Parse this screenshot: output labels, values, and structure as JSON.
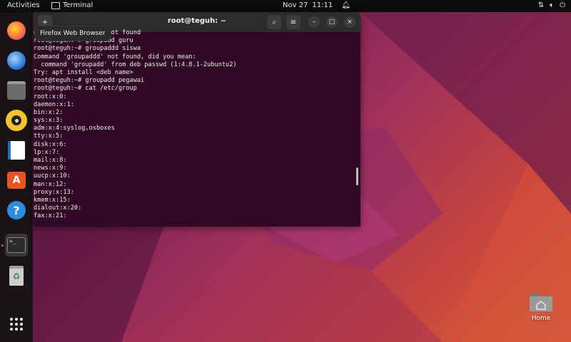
{
  "topbar": {
    "activities": "Activities",
    "app_name": "Terminal",
    "date": "Nov 27",
    "time": "11:11"
  },
  "tooltip": {
    "text": "Firefox Web Browser"
  },
  "dock": {
    "items": [
      {
        "icon": "firefox-icon"
      },
      {
        "icon": "thunderbird-icon"
      },
      {
        "icon": "files-icon"
      },
      {
        "icon": "rhythmbox-icon"
      },
      {
        "icon": "libreoffice-writer-icon"
      },
      {
        "icon": "app-center-icon"
      },
      {
        "icon": "help-icon"
      },
      {
        "icon": "terminal-icon"
      },
      {
        "icon": "trash-icon"
      },
      {
        "icon": "show-apps-icon"
      }
    ]
  },
  "terminal": {
    "title": "root@teguh: ~",
    "lines": [
      "groupaddgr: command not found",
      "root@teguh:~# groupadd guru",
      "root@teguh:~# groupaddd siswa",
      "Command 'groupaddd' not found, did you mean:",
      "  command 'groupadd' from deb passwd (1:4.8.1-2ubuntu2)",
      "Try: apt install <deb name>",
      "root@teguh:~# groupadd pegawai",
      "root@teguh:~# cat /etc/group",
      "root:x:0:",
      "daemon:x:1:",
      "bin:x:2:",
      "sys:x:3:",
      "adm:x:4:syslog,osboxes",
      "tty:x:5:",
      "disk:x:6:",
      "lp:x:7:",
      "mail:x:8:",
      "news:x:9:",
      "uucp:x:10:",
      "man:x:12:",
      "proxy:x:13:",
      "kmem:x:15:",
      "dialout:x:20:",
      "fax:x:21:"
    ]
  },
  "desktop": {
    "home_label": "Home"
  },
  "colors": {
    "accent": "#e95420",
    "terminal_bg": "#300a24"
  }
}
